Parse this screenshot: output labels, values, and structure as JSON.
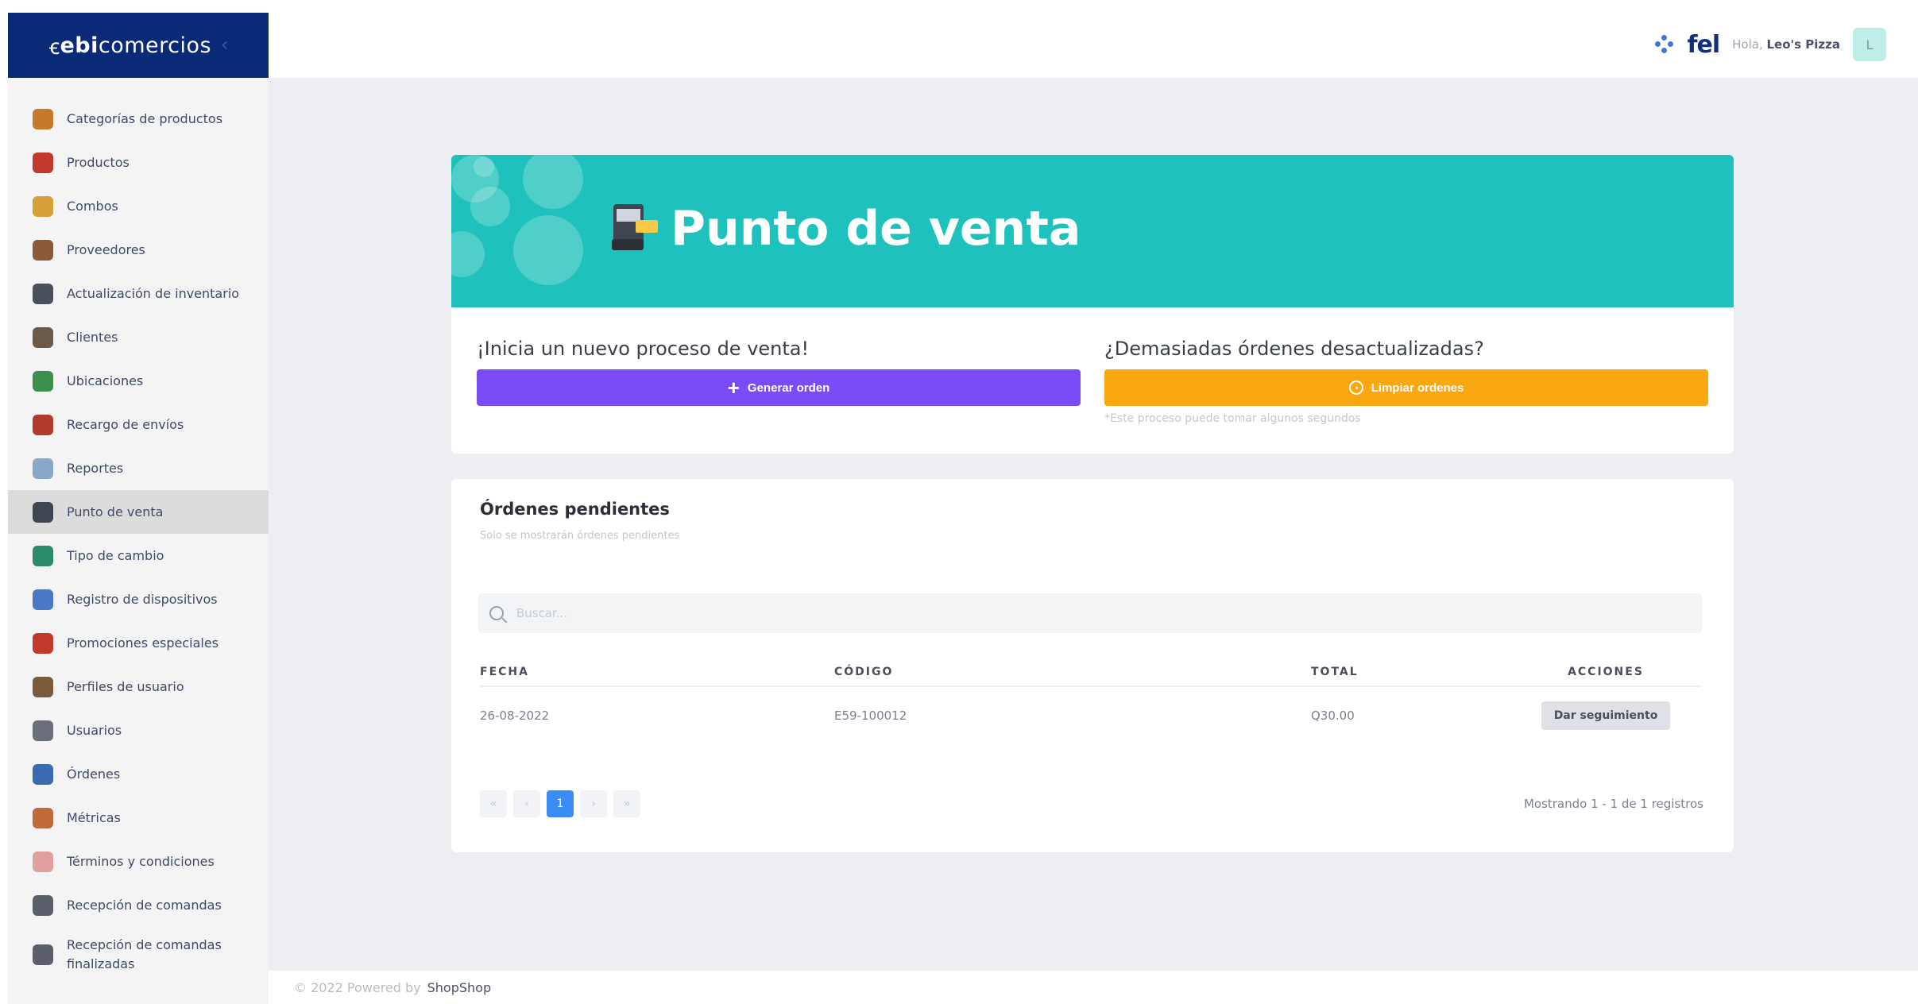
{
  "brand": {
    "bold": "ebi",
    "rest": "comercios",
    "collapse_glyph": "‹",
    "logo_glyph": "ꞓ"
  },
  "sidebar": {
    "items": [
      {
        "label": "Categorías de productos",
        "icon": "categories-icon",
        "color": "#c47a2a"
      },
      {
        "label": "Productos",
        "icon": "products-icon",
        "color": "#c0392b"
      },
      {
        "label": "Combos",
        "icon": "combos-icon",
        "color": "#d6a03a"
      },
      {
        "label": "Proveedores",
        "icon": "suppliers-icon",
        "color": "#8a5a3a"
      },
      {
        "label": "Actualización de inventario",
        "icon": "inventory-icon",
        "color": "#4a4f5c"
      },
      {
        "label": "Clientes",
        "icon": "clients-icon",
        "color": "#6b5a4a"
      },
      {
        "label": "Ubicaciones",
        "icon": "locations-icon",
        "color": "#3e8e4e"
      },
      {
        "label": "Recargo de envíos",
        "icon": "shipping-icon",
        "color": "#b03a2e"
      },
      {
        "label": "Reportes",
        "icon": "reports-icon",
        "color": "#8aa6c8"
      },
      {
        "label": "Punto de venta",
        "icon": "pos-icon",
        "color": "#3f4550",
        "active": true
      },
      {
        "label": "Tipo de cambio",
        "icon": "exchange-icon",
        "color": "#2a8a6a"
      },
      {
        "label": "Registro de dispositivos",
        "icon": "devices-icon",
        "color": "#4a78c8"
      },
      {
        "label": "Promociones especiales",
        "icon": "promotions-icon",
        "color": "#c0392b"
      },
      {
        "label": "Perfiles de usuario",
        "icon": "user-profiles-icon",
        "color": "#7a5a3a"
      },
      {
        "label": "Usuarios",
        "icon": "users-icon",
        "color": "#6b6f7a"
      },
      {
        "label": "Órdenes",
        "icon": "orders-icon",
        "color": "#3a6ab0"
      },
      {
        "label": "Métricas",
        "icon": "metrics-icon",
        "color": "#c06a3a"
      },
      {
        "label": "Términos y condiciones",
        "icon": "terms-icon",
        "color": "#e0a0a0"
      },
      {
        "label": "Recepción de comandas",
        "icon": "order-reception-icon",
        "color": "#5a5f6a"
      },
      {
        "label": "Recepción de comandas finalizadas",
        "icon": "finished-orders-icon",
        "color": "#5a5f6a"
      }
    ]
  },
  "topbar": {
    "fel_logo": "fel",
    "greeting_prefix": "Hola,",
    "user_name": "Leo's Pizza",
    "avatar_initial": "L"
  },
  "hero": {
    "title": "Punto de venta",
    "background": "#1ec1bc"
  },
  "new_sale": {
    "heading": "¡Inicia un nuevo proceso de venta!",
    "button_label": "Generar orden",
    "button_color": "#7b4bf5",
    "plus_glyph": "+"
  },
  "outdated": {
    "heading": "¿Demasiadas órdenes desactualizadas?",
    "button_label": "Limpiar ordenes",
    "button_color": "#fca710",
    "hint": "*Este proceso puede tomar algunos segundos"
  },
  "orders": {
    "title": "Órdenes pendientes",
    "subtitle": "Solo se mostrarán órdenes pendientes",
    "search_placeholder": "Buscar...",
    "columns": {
      "fecha": "FECHA",
      "codigo": "CÓDIGO",
      "total": "TOTAL",
      "acciones": "ACCIONES"
    },
    "rows": [
      {
        "fecha": "26-08-2022",
        "codigo": "E59-100012",
        "total": "Q30.00",
        "action": "Dar seguimiento"
      }
    ],
    "pagination": {
      "first": "«",
      "prev": "‹",
      "current": "1",
      "next": "›",
      "last": "»"
    },
    "showing": "Mostrando 1 - 1 de 1 registros"
  },
  "footer": {
    "copyright": "© 2022 Powered by",
    "brand": "ShopShop"
  }
}
